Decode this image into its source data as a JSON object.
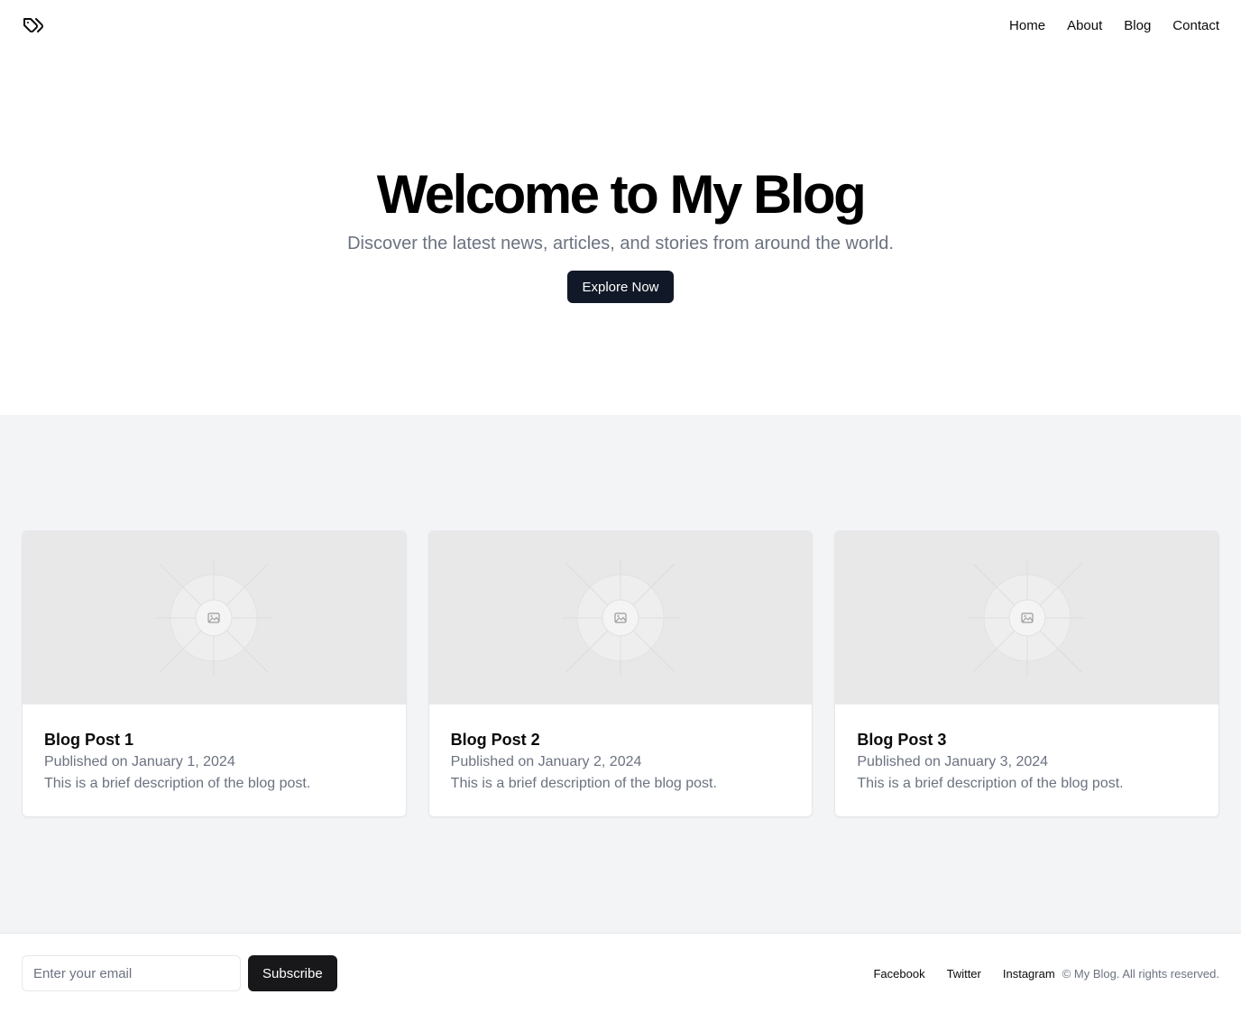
{
  "header": {
    "logo_icon": "tags-icon",
    "nav": [
      {
        "label": "Home"
      },
      {
        "label": "About"
      },
      {
        "label": "Blog"
      },
      {
        "label": "Contact"
      }
    ]
  },
  "hero": {
    "title": "Welcome to My Blog",
    "subtitle": "Discover the latest news, articles, and stories from around the world.",
    "button_label": "Explore Now"
  },
  "posts": [
    {
      "title": "Blog Post 1",
      "date": "Published on January 1, 2024",
      "description": "This is a brief description of the blog post.",
      "image_icon": "image-placeholder-icon"
    },
    {
      "title": "Blog Post 2",
      "date": "Published on January 2, 2024",
      "description": "This is a brief description of the blog post.",
      "image_icon": "image-placeholder-icon"
    },
    {
      "title": "Blog Post 3",
      "date": "Published on January 3, 2024",
      "description": "This is a brief description of the blog post.",
      "image_icon": "image-placeholder-icon"
    }
  ],
  "footer": {
    "email_placeholder": "Enter your email",
    "subscribe_label": "Subscribe",
    "social": [
      {
        "label": "Facebook"
      },
      {
        "label": "Twitter"
      },
      {
        "label": "Instagram"
      }
    ],
    "copyright": "© My Blog. All rights reserved."
  },
  "colors": {
    "primary_button": "#111827",
    "subscribe_button": "#18181b",
    "muted_text": "#6b7280",
    "section_bg": "#f3f4f6",
    "image_placeholder_bg": "#e8e8e8"
  }
}
